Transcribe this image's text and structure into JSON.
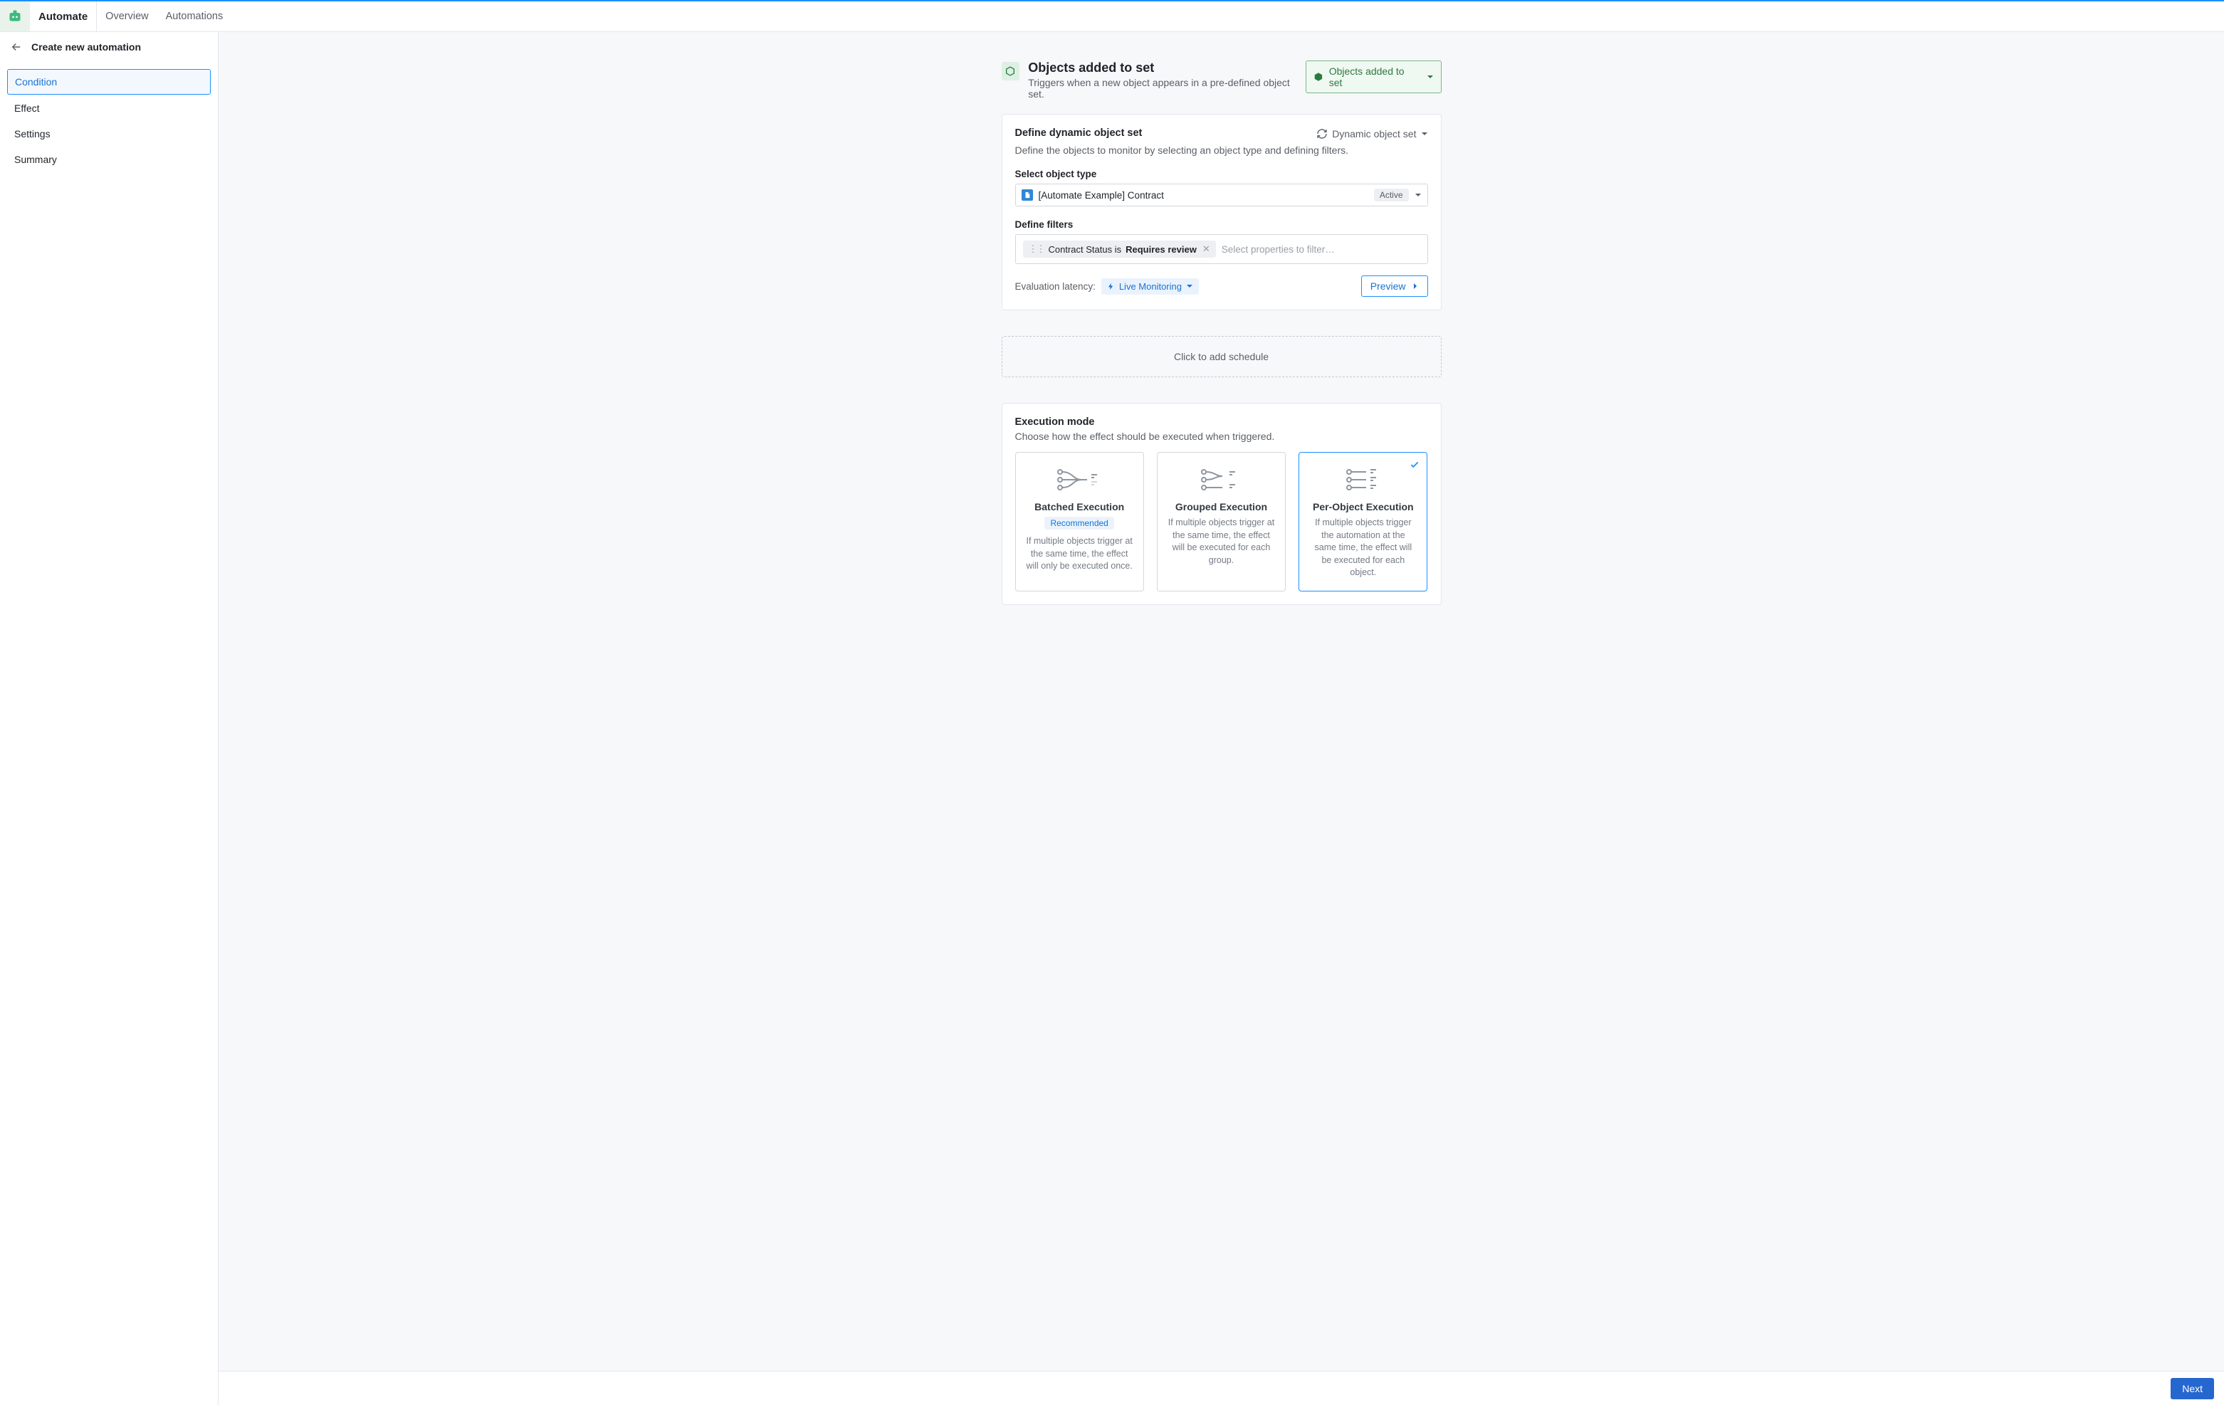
{
  "topbar": {
    "brand": "Automate",
    "nav": [
      "Overview",
      "Automations"
    ]
  },
  "sidebar": {
    "title": "Create new automation",
    "steps": [
      "Condition",
      "Effect",
      "Settings",
      "Summary"
    ],
    "active_index": 0
  },
  "trigger": {
    "title": "Objects added to set",
    "subtitle": "Triggers when a new object appears in a pre-defined object set.",
    "change_btn": "Objects added to set"
  },
  "defineSet": {
    "heading": "Define dynamic object set",
    "sub": "Define the objects to monitor by selecting an object type and defining filters.",
    "mode_btn": "Dynamic object set",
    "selectTypeLabel": "Select object type",
    "objectType": "[Automate Example] Contract",
    "objectStatus": "Active",
    "filtersLabel": "Define filters",
    "filterChipProp": "Contract Status is ",
    "filterChipValue": "Requires review",
    "filterPlaceholder": "Select properties to filter…",
    "evalLabel": "Evaluation latency:",
    "liveLabel": "Live Monitoring",
    "previewLabel": "Preview"
  },
  "schedule": {
    "placeholder": "Click to add schedule"
  },
  "exec": {
    "heading": "Execution mode",
    "sub": "Choose how the effect should be executed when triggered.",
    "options": [
      {
        "title": "Batched Execution",
        "badge": "Recommended",
        "desc": "If multiple objects trigger at the same time, the effect will only be executed once."
      },
      {
        "title": "Grouped Execution",
        "badge": "",
        "desc": "If multiple objects trigger at the same time, the effect will be executed for each group."
      },
      {
        "title": "Per-Object Execution",
        "badge": "",
        "desc": "If multiple objects trigger the automation at the same time, the effect will be executed for each object."
      }
    ],
    "selected_index": 2
  },
  "footer": {
    "next": "Next"
  }
}
